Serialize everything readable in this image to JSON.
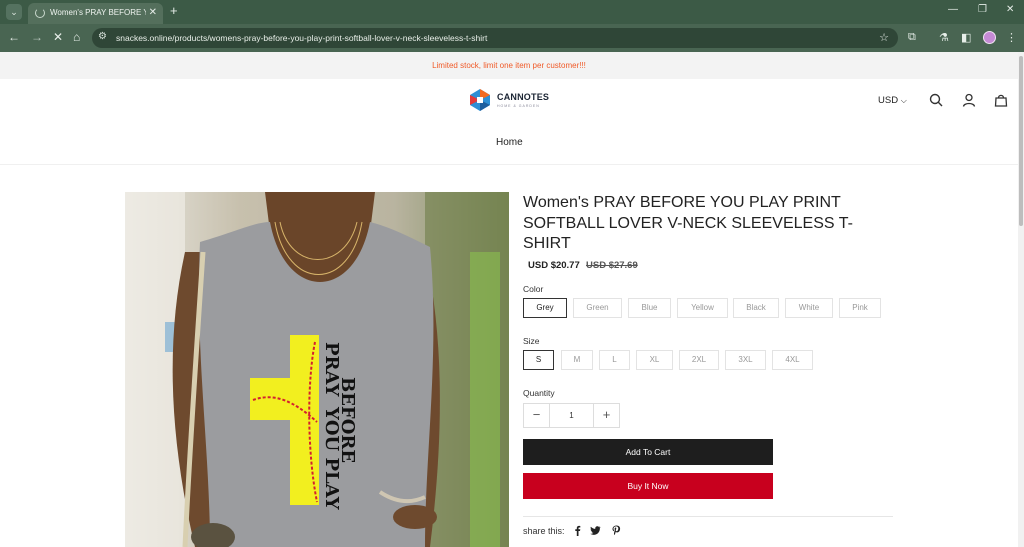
{
  "browser": {
    "tab_title": "Women's PRAY BEFORE YOU PL",
    "url": "snackes.online/products/womens-pray-before-you-play-print-softball-lover-v-neck-sleeveless-t-shirt"
  },
  "announcement": "Limited stock, limit one item per customer!!!",
  "header": {
    "logo_text": "CANNOTES",
    "logo_sub": "HOME & GARDEN",
    "currency": "USD",
    "nav_home": "Home"
  },
  "product": {
    "title": "Women's PRAY BEFORE YOU PLAY PRINT SOFTBALL LOVER V-NECK SLEEVELESS T-SHIRT",
    "price": "USD $20.77",
    "compare_price": "USD $27.69",
    "color_label": "Color",
    "colors": [
      "Grey",
      "Green",
      "Blue",
      "Yellow",
      "Black",
      "White",
      "Pink"
    ],
    "selected_color": "Grey",
    "size_label": "Size",
    "sizes": [
      "S",
      "M",
      "L",
      "XL",
      "2XL",
      "3XL",
      "4XL"
    ],
    "selected_size": "S",
    "quantity_label": "Quantity",
    "quantity": "1",
    "add_to_cart": "Add To Cart",
    "buy_now": "Buy It Now",
    "share_label": "share this:",
    "shirt_print": [
      "PRAY",
      "BEFORE",
      "YOU PLAY"
    ]
  },
  "colors": {
    "tabbar": "#3c5a46",
    "announcement_text": "#f05a28",
    "buy_button": "#c8001e",
    "cart_button": "#1e1e1e"
  }
}
